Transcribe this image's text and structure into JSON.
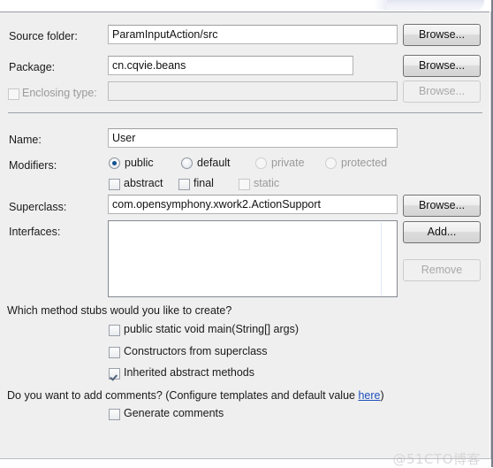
{
  "dialog": {
    "fields": {
      "source_folder": {
        "label": "Source folder:",
        "value": "ParamInputAction/src",
        "browse_label": "Browse..."
      },
      "package": {
        "label": "Package:",
        "value": "cn.cqvie.beans",
        "browse_label": "Browse..."
      },
      "enclosing_type": {
        "label": "Enclosing type:",
        "value": "",
        "checked": false,
        "enabled": false,
        "browse_label": "Browse..."
      },
      "name": {
        "label": "Name:",
        "value": "User"
      },
      "superclass": {
        "label": "Superclass:",
        "value": "com.opensymphony.xwork2.ActionSupport",
        "browse_label": "Browse..."
      },
      "interfaces": {
        "label": "Interfaces:",
        "items": [],
        "add_label": "Add...",
        "remove_label": "Remove"
      }
    },
    "modifiers": {
      "label": "Modifiers:",
      "access": [
        {
          "label": "public",
          "selected": true,
          "enabled": true
        },
        {
          "label": "default",
          "selected": false,
          "enabled": true
        },
        {
          "label": "private",
          "selected": false,
          "enabled": false
        },
        {
          "label": "protected",
          "selected": false,
          "enabled": false
        }
      ],
      "flags": [
        {
          "label": "abstract",
          "checked": false,
          "enabled": true
        },
        {
          "label": "final",
          "checked": false,
          "enabled": true
        },
        {
          "label": "static",
          "checked": false,
          "enabled": false
        }
      ]
    },
    "method_stubs": {
      "question": "Which method stubs would you like to create?",
      "options": [
        {
          "label": "public static void main(String[] args)",
          "checked": false
        },
        {
          "label": "Constructors from superclass",
          "checked": false
        },
        {
          "label": "Inherited abstract methods",
          "checked": true
        }
      ]
    },
    "comments": {
      "question_prefix": "Do you want to add comments? (Configure templates and default value ",
      "link_label": "here",
      "question_suffix": ")",
      "option": {
        "label": "Generate comments",
        "checked": false
      }
    },
    "watermark": "@51CTO博客"
  },
  "colors": {
    "panel_background": "#efefef",
    "field_background": "#ffffff",
    "link": "#1d4fbd",
    "radio_dot": "#13518f",
    "check_mark": "#51647e",
    "disabled_text": "#9a9a9a"
  }
}
